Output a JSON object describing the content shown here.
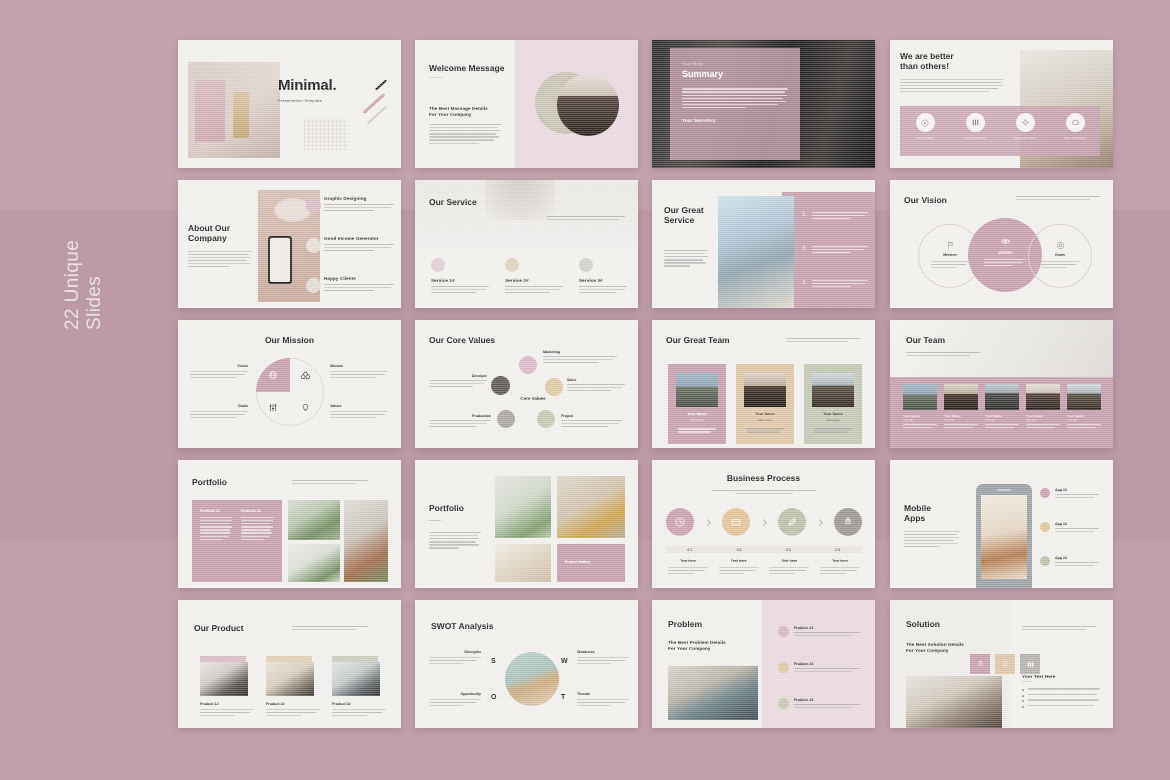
{
  "caption": "22 Unique\nSlides",
  "colors": {
    "backdrop": "#bfa0ab",
    "slide_bg": "#f1efec",
    "accent_pink": "#c49fae",
    "accent_pink_light": "#e9d9de",
    "accent_tan": "#dcc6a7",
    "accent_sage": "#c2c7b4",
    "accent_grey": "#b4b1ac",
    "text_dark": "#1b1b1b"
  },
  "slides": [
    {
      "id": 1,
      "name": "title-slide",
      "title": "Minimal.",
      "subtitle": "Presentation Template"
    },
    {
      "id": 2,
      "name": "welcome-message-slide",
      "title": "Welcome Message",
      "subtitle": "The Best Massage Details\nFor Your Company"
    },
    {
      "id": 3,
      "name": "summary-slide",
      "eyebrow": "Your Story",
      "title": "Summary",
      "signature": "Your Secretary"
    },
    {
      "id": 4,
      "name": "we-are-better-slide",
      "title": "We are better\nthan others!",
      "features": [
        {
          "label": "Video Quality",
          "icon": "play-circle-icon"
        },
        {
          "label": "Quality Sample",
          "icon": "columns-icon"
        },
        {
          "label": "Awesome Office",
          "icon": "gear-icon"
        },
        {
          "label": "Best Teamwork",
          "icon": "cloud-icon"
        }
      ]
    },
    {
      "id": 5,
      "name": "about-our-company-slide",
      "title": "About Our\nCompany",
      "items": [
        {
          "label": "Graphic Designing"
        },
        {
          "label": "Good Income Generator"
        },
        {
          "label": "Happy Clients"
        }
      ]
    },
    {
      "id": 6,
      "name": "our-service-slide",
      "title": "Our Service",
      "items": [
        {
          "label": "Service 1#"
        },
        {
          "label": "Service 2#"
        },
        {
          "label": "Service 3#"
        }
      ]
    },
    {
      "id": 7,
      "name": "our-great-service-slide",
      "title": "Our Great\nService",
      "steps": [
        "1.",
        "2.",
        "3."
      ]
    },
    {
      "id": 8,
      "name": "our-vision-slide",
      "title": "Our Vision",
      "items": [
        {
          "label": "Mission",
          "icon": "flag-icon"
        },
        {
          "label": "Vision",
          "icon": "eye-icon"
        },
        {
          "label": "Goals",
          "icon": "target-icon"
        }
      ]
    },
    {
      "id": 9,
      "name": "our-mission-slide",
      "title": "Our Mission",
      "items": [
        {
          "label": "Vision",
          "icon": "globe-icon"
        },
        {
          "label": "Mission",
          "icon": "binoculars-icon"
        },
        {
          "label": "Goals",
          "icon": "sliders-icon"
        },
        {
          "label": "Values",
          "icon": "bulb-icon"
        }
      ]
    },
    {
      "id": 10,
      "name": "our-core-values-slide",
      "title": "Our Core Values",
      "center_label": "Core Values",
      "items": [
        {
          "label": "Marketing",
          "icon": "megaphone-icon",
          "color": "#d8b7c6"
        },
        {
          "label": "Sales",
          "icon": "chart-icon",
          "color": "#ddc9a5"
        },
        {
          "label": "Project",
          "icon": "columns-icon",
          "color": "#c5c8b3"
        },
        {
          "label": "Production",
          "icon": "cog-icon",
          "color": "#a9a6a1"
        },
        {
          "label": "Develper",
          "icon": "code-icon",
          "color": "#5e5a57"
        }
      ]
    },
    {
      "id": 11,
      "name": "our-great-team-slide",
      "title": "Our Great Team",
      "members": [
        {
          "name": "Your Name",
          "role": "CEO Here",
          "card": "#c49fae"
        },
        {
          "name": "Your Name",
          "role": "CEO Here",
          "card": "#dcc6a7"
        },
        {
          "name": "Your Name",
          "role": "CEO Here",
          "card": "#c2c7b4"
        }
      ]
    },
    {
      "id": 12,
      "name": "our-team-slide",
      "title": "Our Team",
      "members": [
        {
          "name": "Your Name",
          "role": "The Job"
        },
        {
          "name": "Your Name",
          "role": "The Job"
        },
        {
          "name": "Your Name",
          "role": "The Job"
        },
        {
          "name": "Your Name",
          "role": "The Job"
        },
        {
          "name": "Your Name",
          "role": "The Job"
        }
      ]
    },
    {
      "id": 13,
      "name": "portfolio-slide-a",
      "title": "Portfolio",
      "items": [
        {
          "label": "Portfolio 1#"
        },
        {
          "label": "Portfolio 2#"
        }
      ]
    },
    {
      "id": 14,
      "name": "portfolio-slide-b",
      "title": "Portfolio",
      "caption": "Project Gallery"
    },
    {
      "id": 15,
      "name": "business-process-slide",
      "title": "Business Process",
      "steps": [
        {
          "num": "01",
          "label": "Text here",
          "icon": "clock-icon",
          "color": "#c9a0b1"
        },
        {
          "num": "02",
          "label": "Text here",
          "icon": "box-icon",
          "color": "#dfc49a"
        },
        {
          "num": "03",
          "label": "Text here",
          "icon": "leaf-icon",
          "color": "#b9bfa7"
        },
        {
          "num": "04",
          "label": "Text here",
          "icon": "rocket-icon",
          "color": "#9b9893"
        }
      ]
    },
    {
      "id": 16,
      "name": "mobile-apps-slide",
      "title": "Mobile\nApps",
      "items": [
        {
          "label": "App #1",
          "color": "#c9a0b1"
        },
        {
          "label": "App #2",
          "color": "#dfc49a"
        },
        {
          "label": "App #3",
          "color": "#b9bfa7"
        }
      ]
    },
    {
      "id": 17,
      "name": "our-product-slide",
      "title": "Our Product",
      "items": [
        {
          "label": "Product 1#"
        },
        {
          "label": "Product 2#"
        },
        {
          "label": "Product 3#"
        }
      ]
    },
    {
      "id": 18,
      "name": "swot-analysis-slide",
      "title": "SWOT Analysis",
      "letters": [
        "S",
        "W",
        "O",
        "T"
      ],
      "items": [
        {
          "label": "Strengths"
        },
        {
          "label": "Weakness"
        },
        {
          "label": "Opportunity"
        },
        {
          "label": "Threats"
        }
      ]
    },
    {
      "id": 19,
      "name": "problem-slide",
      "title": "Problem",
      "subtitle": "The Best Problem Details\nFor Your Company",
      "items": [
        {
          "label": "Problem #1",
          "color": "#d8b7c6"
        },
        {
          "label": "Problem #2",
          "color": "#ddc9a5"
        },
        {
          "label": "Problem #3",
          "color": "#c5c8b3"
        }
      ]
    },
    {
      "id": 20,
      "name": "solution-slide",
      "title": "Solution",
      "subtitle": "The Best Solution Details\nFor Your Company",
      "list_title": "Your Text Here",
      "chips": [
        {
          "icon": "rocket-icon",
          "color": "#c49fae"
        },
        {
          "icon": "bulb-icon",
          "color": "#dcc6a7"
        },
        {
          "icon": "columns-icon",
          "color": "#b4b1ac"
        }
      ]
    }
  ]
}
